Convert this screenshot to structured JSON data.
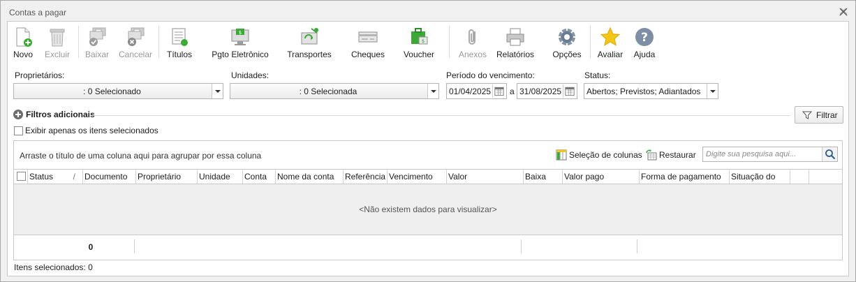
{
  "window": {
    "title": "Contas a pagar"
  },
  "toolbar": {
    "novo": "Novo",
    "excluir": "Excluir",
    "baixar": "Baixar",
    "cancelar": "Cancelar",
    "titulos": "Títulos",
    "pgto": "Pgto Eletrônico",
    "transportes": "Transportes",
    "cheques": "Cheques",
    "voucher": "Voucher",
    "anexos": "Anexos",
    "relatorios": "Relatórios",
    "opcoes": "Opções",
    "avaliar": "Avaliar",
    "ajuda": "Ajuda"
  },
  "filters": {
    "proprietarios_label": "Proprietários:",
    "proprietarios_value": ": 0 Selecionado",
    "unidades_label": "Unidades:",
    "unidades_value": ": 0 Selecionada",
    "periodo_label": "Período do vencimento:",
    "date_from": "01/04/2025",
    "date_sep": "a",
    "date_to": "31/08/2025",
    "status_label": "Status:",
    "status_value": "Abertos; Previstos; Adiantados",
    "advanced_label": "Filtros adicionais",
    "filtrar": "Filtrar",
    "only_selected": "Exibir apenas os itens selecionados"
  },
  "grid": {
    "group_hint": "Arraste o título de uma coluna aqui para agrupar por essa coluna",
    "column_selection": "Seleção de colunas",
    "restore": "Restaurar",
    "search_placeholder": "Digite sua pesquisa aqui...",
    "columns": [
      "Status",
      "Documento",
      "Proprietário",
      "Unidade",
      "Conta",
      "Nome da conta",
      "Referência",
      "Vencimento",
      "Valor",
      "Baixa",
      "Valor pago",
      "Forma de pagamento",
      "Situação do"
    ],
    "empty_message": "<Não existem dados para visualizar>",
    "footer_count": "0"
  },
  "status_bar": {
    "selected_items": "Itens selecionados: 0"
  },
  "colors": {
    "accent_green": "#3aaa35",
    "star": "#f5c518",
    "gear": "#6b7c93"
  }
}
